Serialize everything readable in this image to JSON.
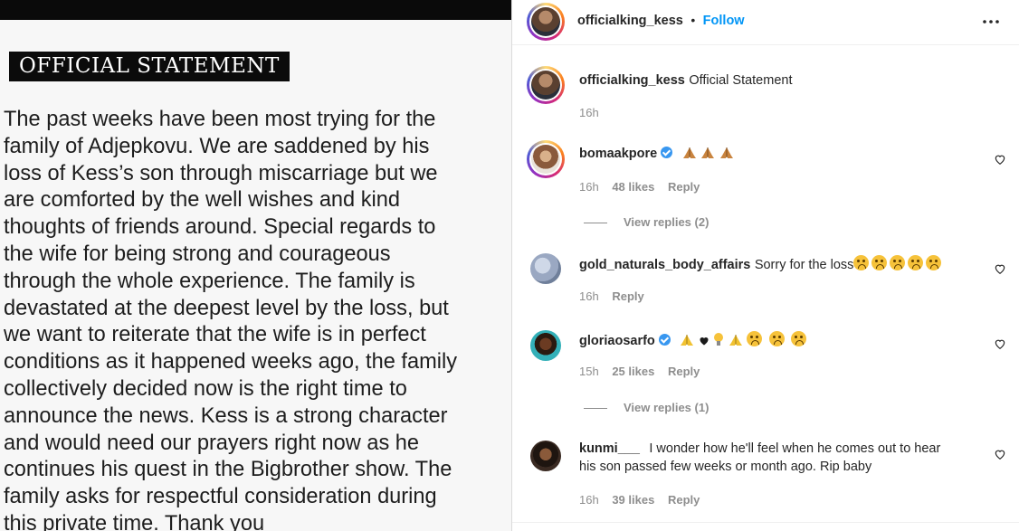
{
  "post": {
    "statement_title": "OFFICIAL STATEMENT",
    "statement_lines": [
      "The past weeks have been most trying for the",
      "family of Adjepkovu. We are saddened by his",
      "loss of Kess’s son through miscarriage but we",
      "are comforted by the well wishes and kind",
      "thoughts of friends around. Special regards to",
      "the wife for being strong and courageous",
      "through the whole experience. The family is",
      "devastated at the deepest level by the loss, but",
      "we want to reiterate that the wife is in perfect",
      "conditions as it happened weeks ago, the family",
      "collectively decided now is the right time to",
      "announce the news. Kess is a strong character",
      "and would need our prayers right now as he",
      "continues his quest in the Bigbrother show. The",
      "family asks for respectful consideration during",
      "this private time. Thank you"
    ]
  },
  "header": {
    "username": "officialking_kess",
    "separator": "•",
    "follow_label": "Follow",
    "more_icon": "more-horizontal-icon"
  },
  "caption": {
    "username": "officialking_kess",
    "text": "Official Statement",
    "time": "16h"
  },
  "comments": [
    {
      "username": "bomaakpore",
      "verified": true,
      "emoji": [
        "folded-hands-icon",
        "folded-hands-icon",
        "folded-hands-icon"
      ],
      "text": "",
      "time": "16h",
      "likes": "48 likes",
      "reply_label": "Reply",
      "view_replies": "View replies (2)"
    },
    {
      "username": "gold_naturals_body_affairs",
      "verified": false,
      "text": "Sorry for the loss",
      "emoji": [
        "sad-face-icon",
        "sad-face-icon",
        "sad-face-icon",
        "sad-face-icon",
        "sad-face-icon"
      ],
      "time": "16h",
      "likes": "",
      "reply_label": "Reply"
    },
    {
      "username": "gloriaosarfo",
      "verified": true,
      "emoji": [
        "folded-hands-icon",
        "heart-icon",
        "light-bulb-icon",
        "folded-hands-icon",
        "tired-face-icon",
        "sad-face-icon",
        "tired-face-icon"
      ],
      "text": "",
      "time": "15h",
      "likes": "25 likes",
      "reply_label": "Reply",
      "view_replies": "View replies (1)"
    },
    {
      "username": "kunmi___",
      "verified": false,
      "text_line1": "I wonder how he'll feel when he comes out to hear",
      "text_line2": "his son passed few weeks or month ago. Rip baby",
      "time": "16h",
      "likes": "39 likes",
      "reply_label": "Reply"
    }
  ],
  "colors": {
    "accent": "#0095f6",
    "muted": "#8e8e8e",
    "verified": "#3897f0",
    "statement_bg": "#0b0b0b"
  }
}
